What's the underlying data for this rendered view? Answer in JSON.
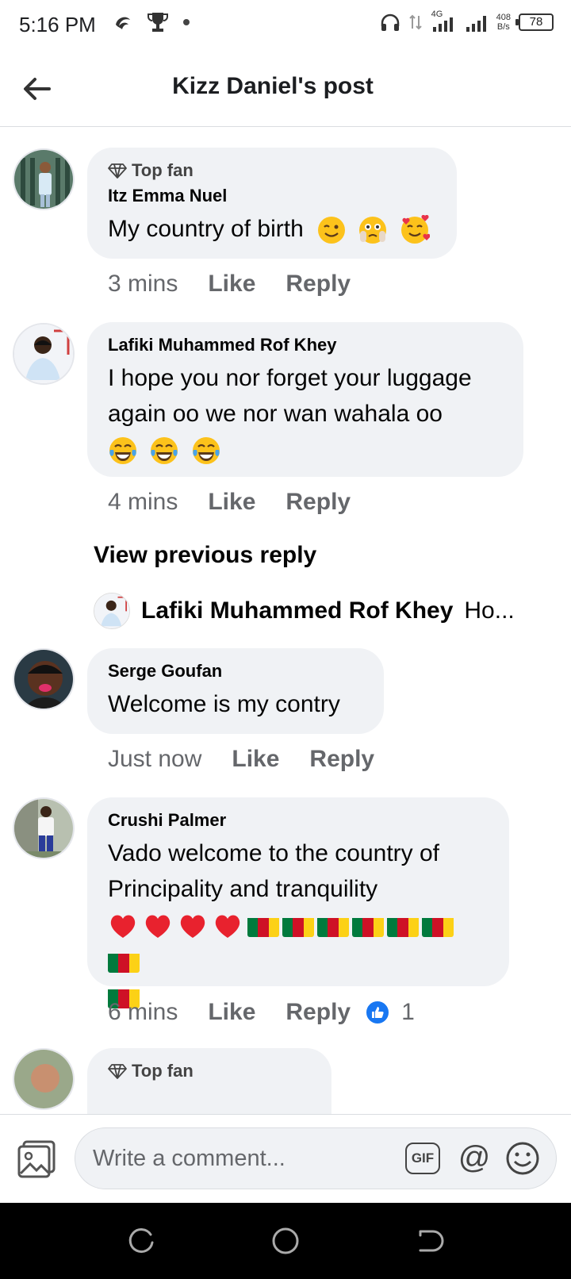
{
  "status_bar": {
    "time": "5:16 PM",
    "network": "4G",
    "speed_value": "408",
    "speed_unit": "B/s",
    "battery": "78"
  },
  "header": {
    "title": "Kizz Daniel's post"
  },
  "comments": [
    {
      "badge": "Top fan",
      "author": "Itz Emma Nuel",
      "text": "My country of birth",
      "time": "3 mins",
      "like": "Like",
      "reply": "Reply"
    },
    {
      "author": "Lafiki Muhammed Rof Khey",
      "text_line1": "I hope you nor forget your luggage",
      "text_line2": "again oo we nor wan wahala oo",
      "time": "4 mins",
      "like": "Like",
      "reply": "Reply"
    },
    {
      "author": "Serge Goufan",
      "text": "Welcome is my contry",
      "time": "Just now",
      "like": "Like",
      "reply": "Reply"
    },
    {
      "author": "Crushi Palmer",
      "text_line1": "Vado welcome to the country of",
      "text_line2": "Principality and tranquility",
      "time": "6 mins",
      "like": "Like",
      "reply": "Reply",
      "reactions": "1"
    },
    {
      "badge": "Top fan"
    }
  ],
  "view_previous": "View previous reply",
  "reply_preview": {
    "author": "Lafiki Muhammed Rof Khey",
    "snippet": "Ho..."
  },
  "composer": {
    "placeholder": "Write a comment...",
    "gif_label": "GIF",
    "at_label": "@"
  },
  "colors": {
    "bubble": "#f0f2f5",
    "meta_text": "#65676b",
    "like_blue": "#1877f2"
  }
}
